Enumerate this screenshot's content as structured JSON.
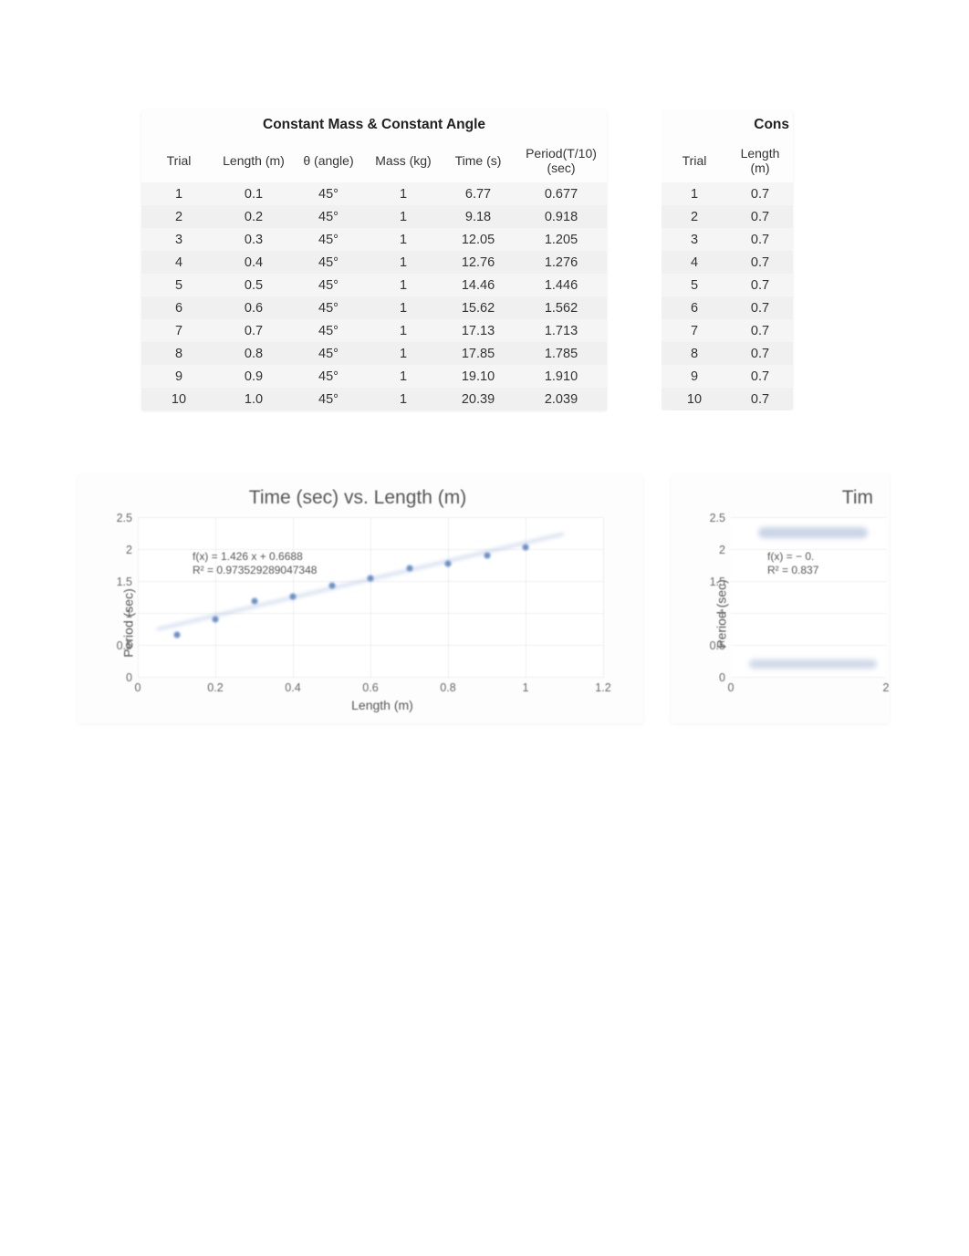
{
  "table1": {
    "title": "Constant Mass & Constant Angle",
    "headers": [
      "Trial",
      "Length (m)",
      "θ (angle)",
      "Mass (kg)",
      "Time (s)",
      "Period(T/10) (sec)"
    ],
    "rows": [
      [
        "1",
        "0.1",
        "45°",
        "1",
        "6.77",
        "0.677"
      ],
      [
        "2",
        "0.2",
        "45°",
        "1",
        "9.18",
        "0.918"
      ],
      [
        "3",
        "0.3",
        "45°",
        "1",
        "12.05",
        "1.205"
      ],
      [
        "4",
        "0.4",
        "45°",
        "1",
        "12.76",
        "1.276"
      ],
      [
        "5",
        "0.5",
        "45°",
        "1",
        "14.46",
        "1.446"
      ],
      [
        "6",
        "0.6",
        "45°",
        "1",
        "15.62",
        "1.562"
      ],
      [
        "7",
        "0.7",
        "45°",
        "1",
        "17.13",
        "1.713"
      ],
      [
        "8",
        "0.8",
        "45°",
        "1",
        "17.85",
        "1.785"
      ],
      [
        "9",
        "0.9",
        "45°",
        "1",
        "19.10",
        "1.910"
      ],
      [
        "10",
        "1.0",
        "45°",
        "1",
        "20.39",
        "2.039"
      ]
    ]
  },
  "table2": {
    "title": "Cons",
    "headers": [
      "Trial",
      "Length (m)"
    ],
    "rows": [
      [
        "1",
        "0.7"
      ],
      [
        "2",
        "0.7"
      ],
      [
        "3",
        "0.7"
      ],
      [
        "4",
        "0.7"
      ],
      [
        "5",
        "0.7"
      ],
      [
        "6",
        "0.7"
      ],
      [
        "7",
        "0.7"
      ],
      [
        "8",
        "0.7"
      ],
      [
        "9",
        "0.7"
      ],
      [
        "10",
        "0.7"
      ]
    ]
  },
  "chart1": {
    "title": "Time (sec) vs. Length (m)",
    "ylabel": "Period (sec)",
    "xlabel": "Length (m)",
    "eq1": "f(x) = 1.426 x + 0.6688",
    "eq2": "R² = 0.973529289047348",
    "yticks": [
      "0",
      "0.5",
      "1",
      "1.5",
      "2",
      "2.5"
    ],
    "xticks": [
      "0",
      "0.2",
      "0.4",
      "0.6",
      "0.8",
      "1",
      "1.2"
    ]
  },
  "chart2": {
    "title": "Tim",
    "ylabel": "Period (sec)",
    "eq1": "f(x) = − 0.",
    "eq2": "R² = 0.837",
    "yticks": [
      "0",
      "0.5",
      "1",
      "1.5",
      "2",
      "2.5"
    ],
    "xticks": [
      "0",
      "2"
    ]
  },
  "chart_data": [
    {
      "type": "scatter",
      "title": "Time (sec) vs. Length (m)",
      "xlabel": "Length (m)",
      "ylabel": "Period (sec)",
      "xlim": [
        0,
        1.2
      ],
      "ylim": [
        0,
        2.5
      ],
      "x": [
        0.1,
        0.2,
        0.3,
        0.4,
        0.5,
        0.6,
        0.7,
        0.8,
        0.9,
        1.0
      ],
      "y": [
        0.677,
        0.918,
        1.205,
        1.276,
        1.446,
        1.562,
        1.713,
        1.785,
        1.91,
        2.039
      ],
      "trendline": {
        "slope": 1.426,
        "intercept": 0.6688,
        "r2": 0.973529289047348
      }
    },
    {
      "type": "scatter",
      "title": "Tim",
      "xlabel": "",
      "ylabel": "Period (sec)",
      "xlim": [
        0,
        2
      ],
      "ylim": [
        0,
        2.5
      ],
      "x": [],
      "y": [],
      "trendline": {
        "r2": 0.837
      }
    }
  ]
}
